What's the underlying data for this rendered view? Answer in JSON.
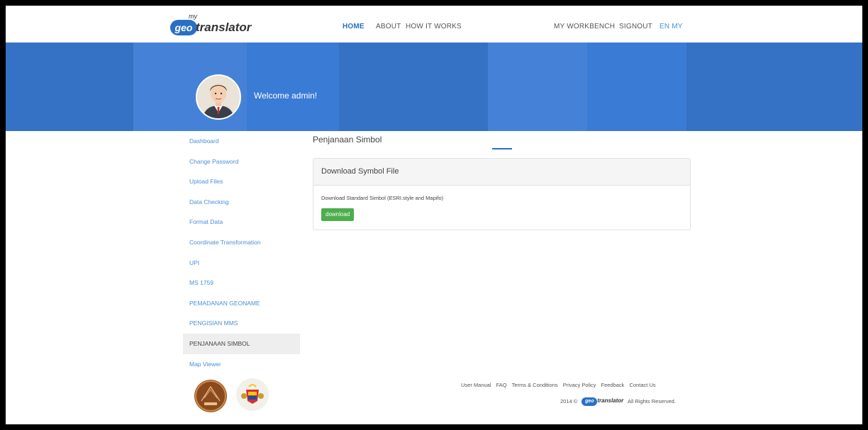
{
  "brand": {
    "my": "my",
    "geo": "geo",
    "translator": "translator"
  },
  "nav": {
    "home": "HOME",
    "about": "ABOUT",
    "how_it_works": "HOW IT WORKS",
    "workbench": "MY WORKBENCH",
    "signout": "SIGNOUT",
    "lang": "EN MY"
  },
  "banner": {
    "welcome": "Welcome admin!"
  },
  "sidebar": {
    "items": [
      {
        "label": "Dashboard"
      },
      {
        "label": "Change Password"
      },
      {
        "label": "Upload Files"
      },
      {
        "label": "Data Checking"
      },
      {
        "label": "Format Data"
      },
      {
        "label": "Coordinate Transformation"
      },
      {
        "label": "UPI"
      },
      {
        "label": "MS 1759"
      },
      {
        "label": "PEMADANAN GEONAME"
      },
      {
        "label": "PENGISIAN MMS"
      },
      {
        "label": "PENJANAAN SIMBOL"
      },
      {
        "label": "Map Viewer"
      }
    ],
    "active_index": 10
  },
  "main": {
    "title": "Penjanaan Simbol",
    "panel_title": "Download Symbol File",
    "panel_desc": "Download Standard Simbol (ESRI.style and Mapifo)",
    "download_label": "download"
  },
  "footer": {
    "links": [
      "User Manual",
      "FAQ",
      "Terms & Conditions",
      "Privacy Policy",
      "Feedback",
      "Contact Us"
    ],
    "year": "2014 ©",
    "rights": "All Rights Reserved."
  },
  "colors": {
    "primary": "#2a6fc4",
    "banner": "#3a7bd5",
    "link": "#4a8fd8",
    "button": "#4cae4c"
  }
}
